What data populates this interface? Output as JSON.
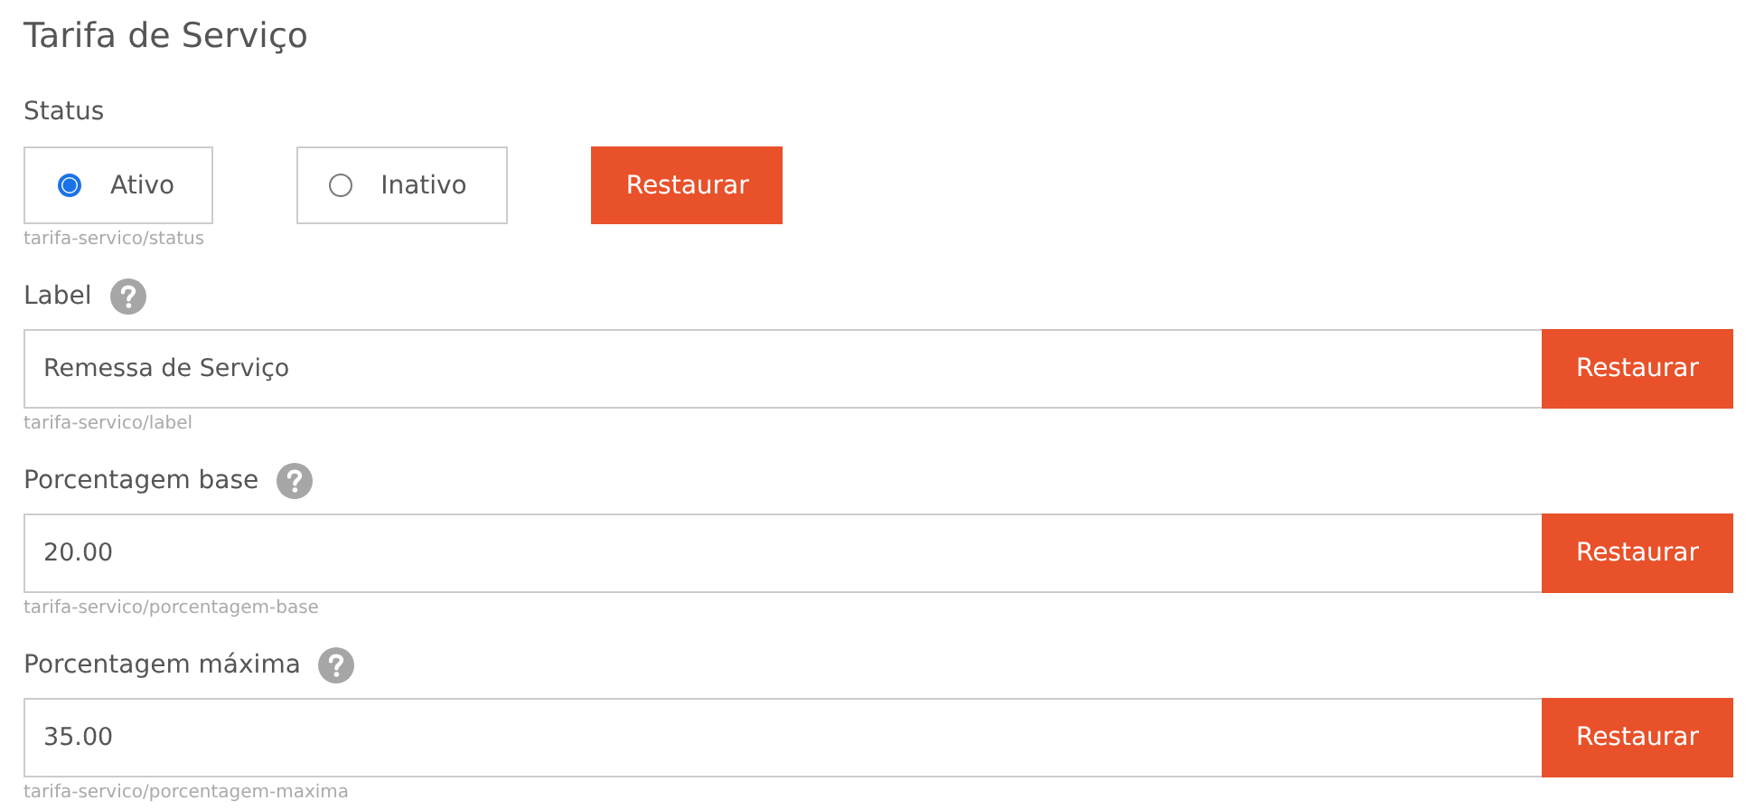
{
  "title": "Tarifa de Serviço",
  "fields": [
    {
      "kind": "radio",
      "label": "Status",
      "options": [
        {
          "label": "Ativo",
          "selected": true
        },
        {
          "label": "Inativo",
          "selected": false
        }
      ],
      "button": "Restaurar",
      "hint": "tarifa-servico/status"
    },
    {
      "kind": "text",
      "label": "Label",
      "value": "Remessa de Serviço",
      "button": "Restaurar",
      "hint": "tarifa-servico/label"
    },
    {
      "kind": "text",
      "label": "Porcentagem base",
      "value": "20.00",
      "button": "Restaurar",
      "hint": "tarifa-servico/porcentagem-base"
    },
    {
      "kind": "text",
      "label": "Porcentagem máxima",
      "value": "35.00",
      "button": "Restaurar",
      "hint": "tarifa-servico/porcentagem-maxima"
    }
  ]
}
